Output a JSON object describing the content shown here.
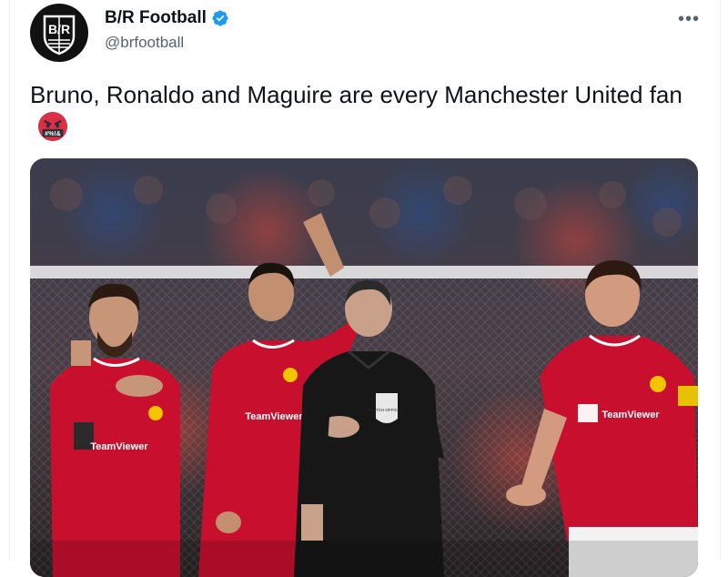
{
  "tweet": {
    "author": {
      "display_name": "B/R Football",
      "handle": "@brfootball",
      "avatar_text": "B/R",
      "verified": true
    },
    "text": "Bruno, Ronaldo and Maguire are every Manchester United fan",
    "emoji": "face-with-symbols-on-mouth",
    "emoji_text": "#%!&",
    "more_icon": "more-horizontal-icon",
    "media": {
      "type": "photo",
      "shirt_text": "TeamViewer",
      "referee_badge_text": "MATCH OFFICIAL"
    }
  },
  "colors": {
    "text": "#0f1419",
    "secondary": "#536471",
    "verified": "#1d9bf0",
    "united_red": "#c8102e"
  }
}
